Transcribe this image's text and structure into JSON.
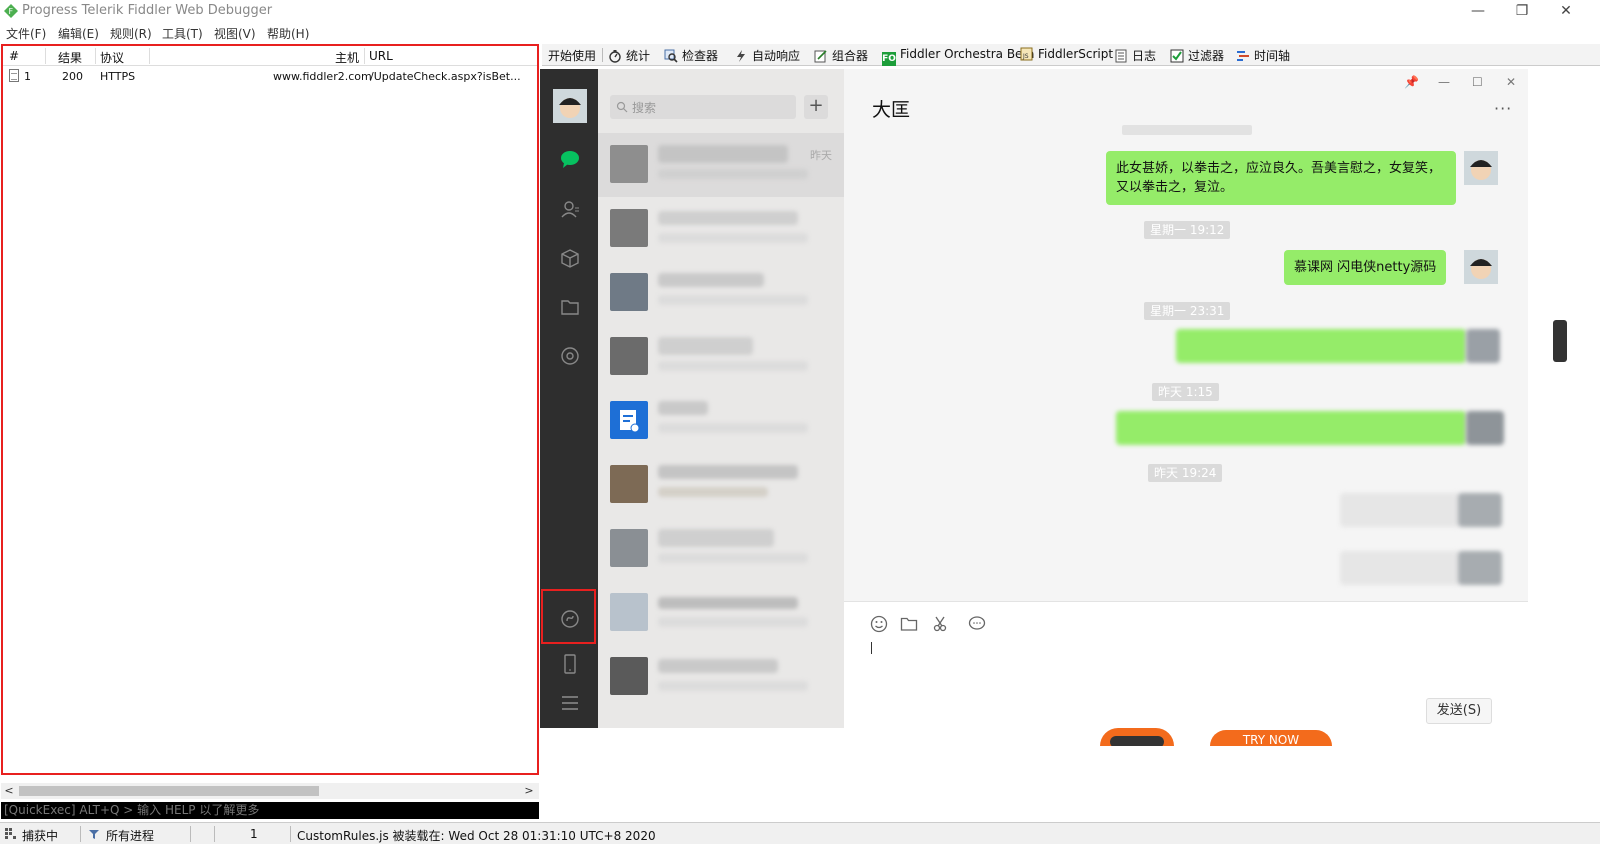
{
  "window": {
    "title": "Progress Telerik Fiddler Web Debugger",
    "controls": [
      "—",
      "❐",
      "✕"
    ]
  },
  "menu": [
    "文件(F)",
    "编辑(E)",
    "规则(R)",
    "工具(T)",
    "视图(V)",
    "帮助(H)"
  ],
  "sessions": {
    "columns": [
      "#",
      "结果",
      "协议",
      "主机",
      "URL"
    ],
    "rows": [
      {
        "num": "1",
        "result": "200",
        "protocol": "HTTPS",
        "host": "www.fiddler2.com",
        "url": "/UpdateCheck.aspx?isBet..."
      }
    ]
  },
  "quickexec": {
    "placeholder": "[QuickExec] ALT+Q > 输入 HELP 以了解更多"
  },
  "tabs": [
    "开始使用",
    "统计",
    "检查器",
    "自动响应",
    "组合器",
    "Fiddler Orchestra Beta",
    "FiddlerScript",
    "日志",
    "过滤器",
    "时间轴"
  ],
  "tab_badge_fo": "FO",
  "wechat": {
    "search_placeholder": "搜索",
    "plus": "+",
    "first_item_time": "昨天",
    "chat_title": "大匡",
    "more": "···",
    "window_controls": [
      "📌",
      "—",
      "☐",
      "✕"
    ],
    "timestamps": [
      "星期一 19:12",
      "星期一 23:31",
      "昨天 1:15",
      "昨天 19:24"
    ],
    "messages": [
      {
        "text": "此女甚娇，以拳击之，应泣良久。吾美言慰之，女复笑，又以拳击之，复泣。"
      },
      {
        "text": "慕课网 闪电侠netty源码"
      }
    ],
    "send_label": "发送(S)"
  },
  "ad": {
    "try_now": "TRY NOW"
  },
  "status": {
    "capturing": "捕获中",
    "processes": "所有进程",
    "count": "1",
    "message": "CustomRules.js 被装载在: Wed Oct 28 01:31:10 UTC+8 2020"
  },
  "colors": {
    "highlight_border": "#e8201f",
    "wechat_green": "#95ec69",
    "wechat_sidebar": "#2e2e2e",
    "wechat_icon_green": "#07c160"
  }
}
